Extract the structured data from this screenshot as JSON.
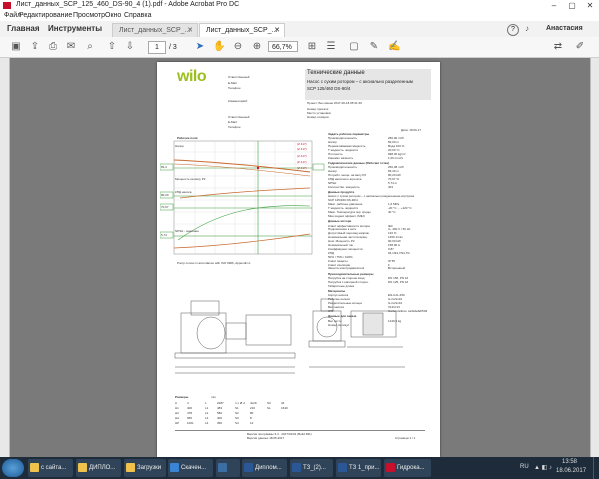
{
  "window": {
    "title": "Лист_данных_SCP_125_460_DS-90_4 (1).pdf - Adobe Acrobat Pro DC",
    "min": "–",
    "max": "▢",
    "close": "✕"
  },
  "menu": [
    "Файл",
    "Редактирование",
    "Просмотр",
    "Окно",
    "Справка"
  ],
  "nav": {
    "home": "Главная",
    "tools": "Инструменты",
    "tab1": "Лист_данных_SCP_...",
    "tab2": "Лист_данных_SCP_...",
    "help": "?",
    "user": "Анастасия"
  },
  "toolbar": {
    "page_current": "1",
    "page_total": "/ 3",
    "zoom": "66,7%"
  },
  "document": {
    "logo": "wilo",
    "header_title": "Технические данные",
    "header_sub1": "Насос с сухим ротором – с аксиально разделенным",
    "header_sub2": "SCP 125/460 DS-90/4",
    "left_fields": [
      "Ответственный",
      "E-Mail",
      "Телефон",
      "",
      "Комментарий:",
      "",
      "",
      "Ответственный",
      "E-Mail",
      "Телефон"
    ],
    "project_row": "Проект:  Без имени  2017-06-18 05:31:39",
    "number_labels": [
      "Номер проекта:",
      "Место установки:",
      "Номер позиции:"
    ],
    "date_row": "Дата: 18.06.17",
    "curve_title": "Рабочие поля",
    "curve_note": "Pump curves in accordance with ISO 9906, Appendix A",
    "spec_section1": "Задать рабочие параметры",
    "spec_rows1": [
      [
        "Производительность",
        "250,00 m³/h"
      ],
      [
        "Напор",
        "83,00 m"
      ],
      [
        "Перекачиваемая жидкость",
        "Вода 100 %"
      ],
      [
        "Т жидкость. жидкости",
        "20,00 °C"
      ],
      [
        "Плотность",
        "998,30 kg/m³"
      ],
      [
        "Кинемат. вязкость",
        "1,00 mm²/s"
      ]
    ],
    "spec_section2": "Гидравлические данные (Рабочая точка)",
    "spec_rows2": [
      [
        "Производительность",
        "250,38 m³/h"
      ],
      [
        "Напор",
        "83,40 m"
      ],
      [
        "Потребл. мощн. на валу P2",
        "80,20 kW"
      ],
      [
        "КПД насосного агрегата",
        "70,67 %"
      ],
      [
        "NPSH",
        "5,74 m"
      ],
      [
        "Количество. мощность",
        "403"
      ]
    ],
    "spec_section3": "Данные продукта",
    "spec_rows3": [
      [
        "Насос с сухим ротором – с аксиально разделенным корпусом",
        ""
      ],
      [
        "SCP 125/460 DS-90/4",
        ""
      ],
      [
        "Макс. рабочее давление",
        "1,6 MPa"
      ],
      [
        "Т жидкость. жидкости",
        "-20 °C ... +120 °C"
      ],
      [
        "Макс. Температура окр. среды",
        "40 °C"
      ],
      [
        "Мин индекс эффект. (MEI)",
        ""
      ]
    ],
    "spec_section4": "Данные мотора",
    "spec_rows4": [
      [
        "Класс эффективности мотора",
        "IE3"
      ],
      [
        "Подключение к сети",
        "3~ 400 V / 50 Hz"
      ],
      [
        "Допустимый перепад напряж.",
        "±10 %"
      ],
      [
        "Номинальная частота вращ.",
        "1450 1/min"
      ],
      [
        "Ном. Мощность P2",
        "90,00 kW"
      ],
      [
        "Номинальный ток",
        "158,00 A"
      ],
      [
        "Коэффициент мощности",
        "0,87"
      ],
      [
        "КПД",
        "94,1/94,7/94,7%"
      ],
      [
        "50% / 75% / 100%",
        ""
      ],
      [
        "Класс защиты",
        "IP 55"
      ],
      [
        "Класс изоляции",
        "F"
      ],
      [
        "Защита электродвигателя",
        "Встроенный"
      ]
    ],
    "spec_section5": "Присоединительные размеры",
    "spec_rows5": [
      [
        "Патрубок на стороне вход.",
        "DN 150, PN 16"
      ],
      [
        "Патрубок с напорной сторон.",
        "DN 125, PN 16"
      ],
      [
        "Габаритные длина",
        ""
      ]
    ],
    "spec_section6": "Материалы",
    "spec_rows6": [
      [
        "Корпус насоса",
        "EN-GJL-250"
      ],
      [
        "Рабочее колесо",
        "G-CuSn10"
      ],
      [
        "Разделительные кольца",
        "G-CuSn10"
      ],
      [
        "Вал насоса",
        "X12Cr13"
      ],
      [
        "СТУ",
        "Carbon/silicon carbide/EPDM"
      ]
    ],
    "spec_section7": "Данные для заказа",
    "spec_rows7": [
      [
        "Вес нетто",
        "1249,5 kg"
      ],
      [
        "Номер Артикул",
        ""
      ]
    ],
    "dims_title": "Размеры",
    "dims_unit": "mm",
    "dims_rows": [
      [
        "A",
        "4",
        "L",
        "2287",
        "n x Ø d",
        "4x29",
        "S3",
        "44"
      ],
      [
        "H1",
        "400",
        "L1",
        "483",
        "S1",
        "210",
        "SL",
        "1640"
      ],
      [
        "H2",
        "478",
        "L2",
        "580",
        "S2",
        "80",
        "",
        ""
      ],
      [
        "HA",
        "965",
        "L3",
        "400",
        "S3",
        "8",
        "",
        ""
      ],
      [
        "HP",
        "1001",
        "L4",
        "350",
        "S4",
        "12",
        "",
        ""
      ]
    ],
    "footer1": "Версия программы 3.4  ·  2017/01/01 (Build 381)",
    "footer2": "Версия данных  18.05.2017",
    "footer3": "Страница 1 / 1",
    "curve_labels": [
      "Напор",
      "Мощность на валу P2",
      "КПД насоса",
      "NPSH - значение"
    ],
    "curve_badges": [
      "(Z 417)",
      "(Z 417)",
      "(Z 417)",
      "(Z 417)",
      "(Z 417)"
    ],
    "curve_yvals": [
      "83,4",
      "80,20",
      "70,67",
      "5,74"
    ]
  },
  "taskbar": {
    "items": [
      {
        "label": "с сайта...",
        "color": "#f0c24b"
      },
      {
        "label": "ДИПЛО...",
        "color": "#f0c24b"
      },
      {
        "label": "Загрузки",
        "color": "#f0c24b"
      },
      {
        "label": "Скачен...",
        "color": "#3a84d6"
      },
      {
        "label": "",
        "color": "#3b6ea5"
      },
      {
        "label": "Диплом...",
        "color": "#2b5797"
      },
      {
        "label": "ТЗ_(2)...",
        "color": "#2b5797"
      },
      {
        "label": "ТЗ 1_при...",
        "color": "#2b5797"
      },
      {
        "label": "Гидрока...",
        "color": "#c8102e"
      }
    ],
    "lang": "RU",
    "time": "13:58",
    "date": "18.06.2017"
  },
  "colors": {
    "taskbar": "#1d2b3b",
    "wilo_green": "#9bbf1e",
    "acrobat_red": "#c8102e",
    "pointer_blue": "#2a6ebb"
  }
}
